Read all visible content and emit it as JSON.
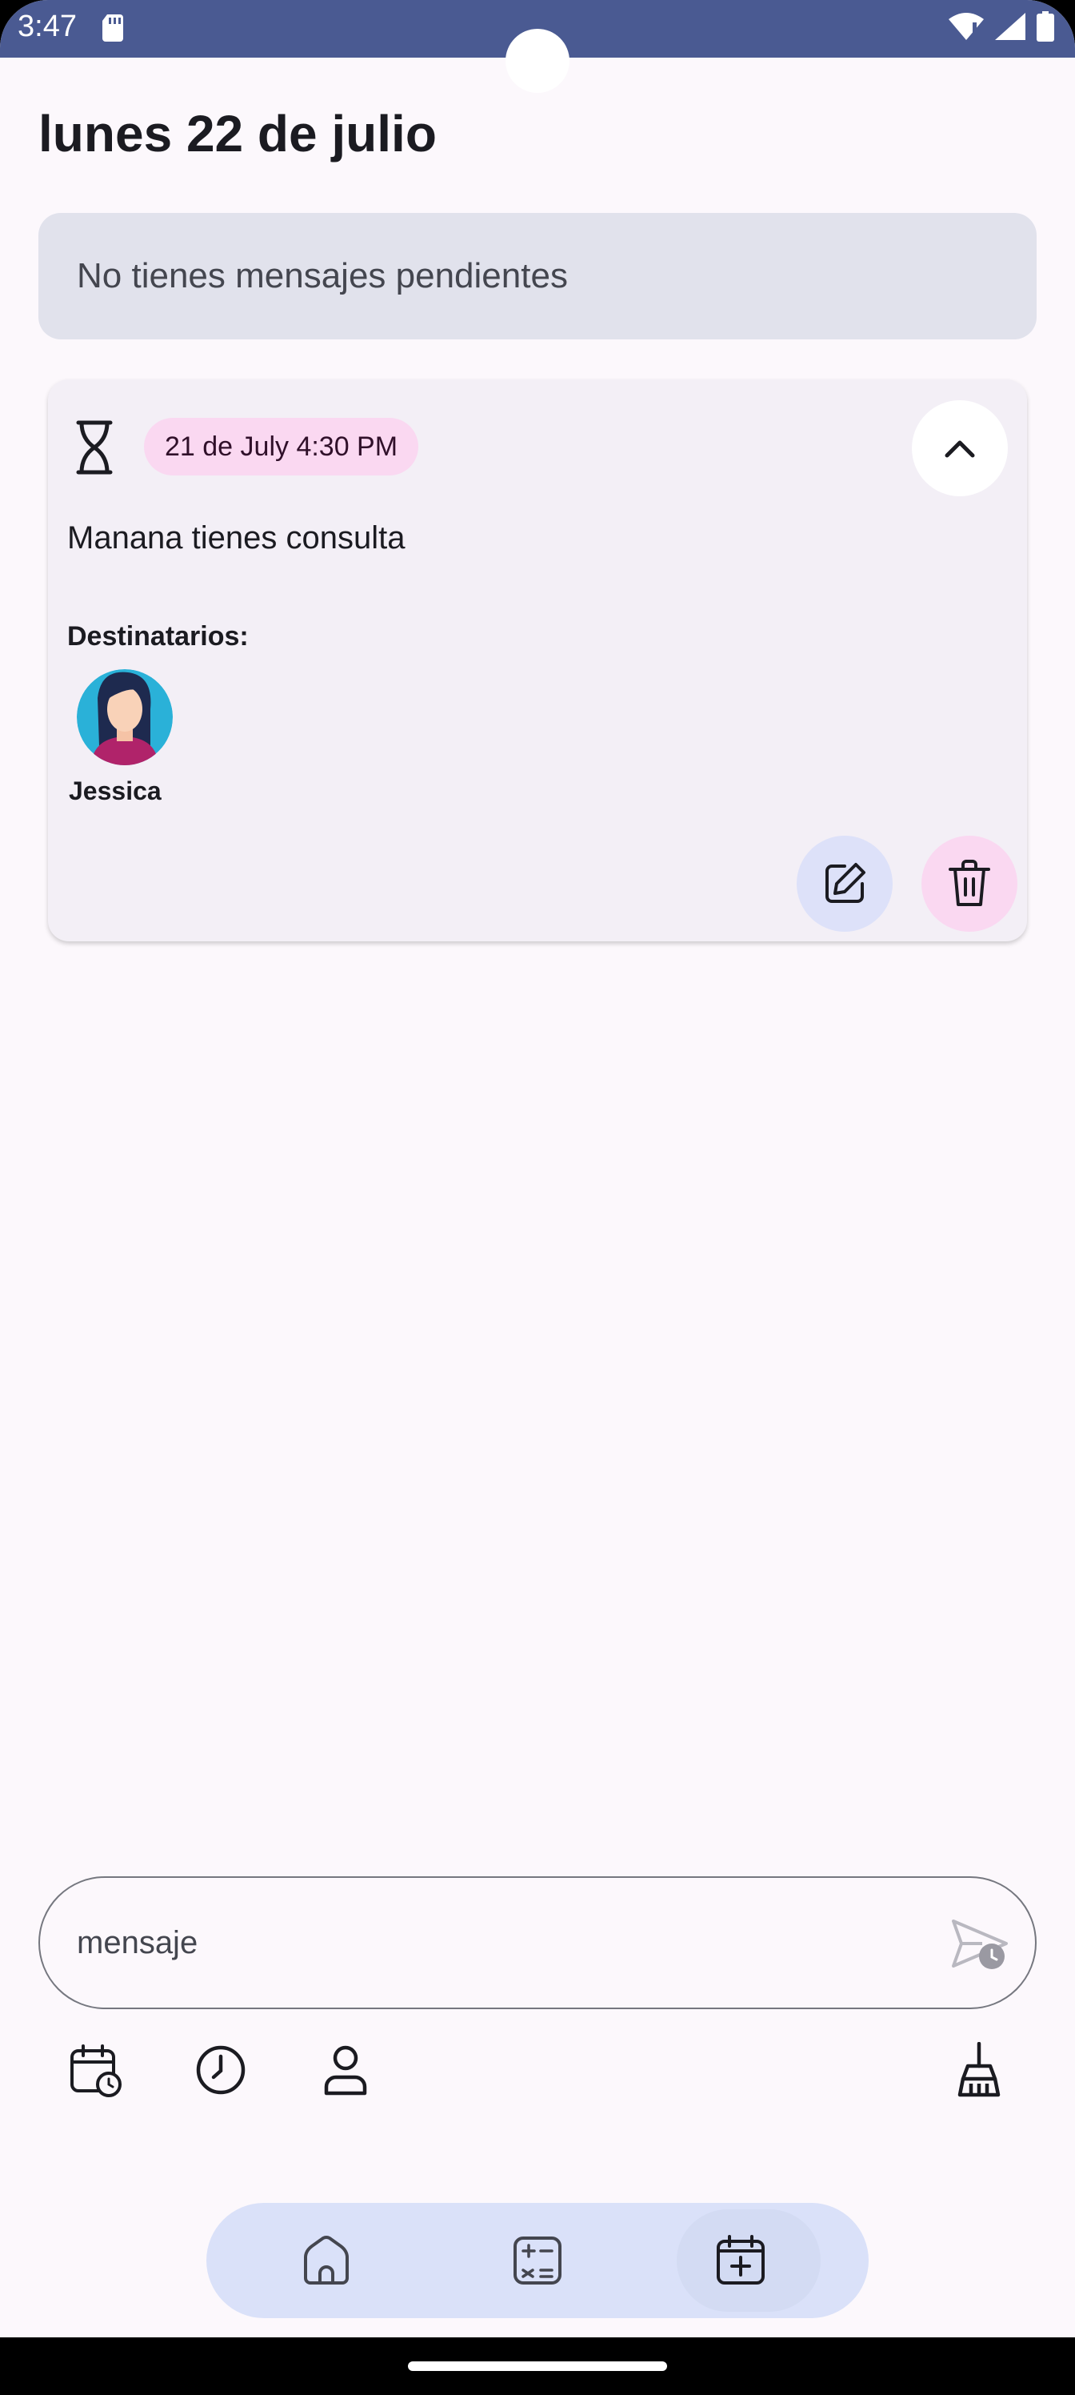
{
  "status_bar": {
    "time": "3:47"
  },
  "header": {
    "date_title": "lunes 22 de julio"
  },
  "pending_banner": {
    "text": "No tienes mensajes pendientes"
  },
  "message_card": {
    "date_chip": "21 de July 4:30 PM",
    "message": "Manana tienes consulta",
    "recipients_label": "Destinatarios:",
    "recipients": [
      {
        "name": "Jessica"
      }
    ]
  },
  "composer": {
    "placeholder": "mensaje"
  },
  "toolbar": {
    "icons": [
      "calendar-schedule-icon",
      "clock-icon",
      "person-icon",
      "broom-icon"
    ]
  },
  "bottom_nav": {
    "items": [
      "home-icon",
      "calculator-icon",
      "calendar-add-icon"
    ],
    "active_index": 2
  },
  "colors": {
    "status_bar": "#4a5a92",
    "background": "#fcf8fc",
    "banner": "#e1e2ec",
    "card": "#f3eff6",
    "chip_pink": "#fad8f1",
    "edit_blue": "#dde1f9",
    "nav_bg": "#dae1f9"
  }
}
